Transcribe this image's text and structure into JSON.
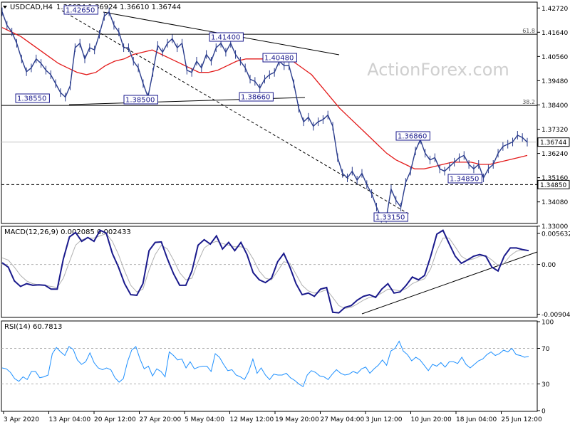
{
  "chart_data": [
    {
      "type": "line",
      "panel": "price",
      "title": "USDCAD,H4",
      "ohlc_header": "1.36624 1.36924 1.36610 1.36744",
      "watermark": "ActionForex.com",
      "ylim": [
        1.3315,
        1.4295
      ],
      "ytick_labels": [
        "1.42720",
        "1.41640",
        "1.40560",
        "1.39480",
        "1.38400",
        "1.37320",
        "1.36240",
        "1.35160",
        "1.34080",
        "1.33000"
      ],
      "ytick_values": [
        1.4272,
        1.4164,
        1.4056,
        1.3948,
        1.384,
        1.3732,
        1.3624,
        1.3516,
        1.3408,
        1.33
      ],
      "xtick_labels": [
        "3 Apr 2020",
        "13 Apr 04:00",
        "20 Apr 12:00",
        "27 Apr 20:00",
        "5 May 04:00",
        "12 May 12:00",
        "19 May 20:00",
        "27 May 04:00",
        "3 Jun 12:00",
        "10 Jun 20:00",
        "18 Jun 04:00",
        "25 Jun 12:00"
      ],
      "fib_levels": [
        {
          "label": "61.8",
          "value": 1.4155
        },
        {
          "label": "38.2",
          "value": 1.3838
        }
      ],
      "reference_levels": [
        {
          "label": "1.36744",
          "value": 1.36744,
          "style": "solid",
          "type": "current"
        },
        {
          "label": "1.34850",
          "value": 1.3485,
          "style": "dashed",
          "type": "support"
        }
      ],
      "annotations": [
        "1.42650",
        "1.41400",
        "1.40480",
        "1.38550",
        "1.38500",
        "1.38660",
        "1.36860",
        "1.34850",
        "1.33150"
      ],
      "annotation_values": [
        1.4265,
        1.414,
        1.4048,
        1.3855,
        1.385,
        1.3866,
        1.3686,
        1.3485,
        1.3315
      ],
      "series": [
        {
          "name": "",
          "color": "#2a3c8c",
          "values": [
            1.4255,
            1.4195,
            1.4165,
            1.4115,
            1.4045,
            1.3988,
            1.4005,
            1.4045,
            1.4025,
            1.3995,
            1.3975,
            1.3935,
            1.3895,
            1.3875,
            1.3925,
            1.4095,
            1.4115,
            1.4045,
            1.4095,
            1.4085,
            1.4155,
            1.4235,
            1.4255,
            1.4195,
            1.4165,
            1.4095,
            1.4095,
            1.4035,
            1.4005,
            1.3935,
            1.3875,
            1.3985,
            1.4105,
            1.4075,
            1.4115,
            1.4135,
            1.4095,
            1.4115,
            1.3995,
            1.3985,
            1.4035,
            1.4005,
            1.4065,
            1.4035,
            1.4095,
            1.4115,
            1.4075,
            1.4115,
            1.4065,
            1.4035,
            1.4005,
            1.3955,
            1.3945,
            1.3915,
            1.3955,
            1.3975,
            1.3985,
            1.4035,
            1.4015,
            1.4015,
            1.3935,
            1.3825,
            1.3765,
            1.3785,
            1.3745,
            1.3765,
            1.3775,
            1.3795,
            1.3745,
            1.3605,
            1.3535,
            1.3515,
            1.3545,
            1.3505,
            1.3535,
            1.3485,
            1.3445,
            1.3385,
            1.3335,
            1.3335,
            1.3465,
            1.3415,
            1.3385,
            1.3495,
            1.3545,
            1.3635,
            1.3685,
            1.3625,
            1.3595,
            1.3605,
            1.3555,
            1.3545,
            1.3565,
            1.3585,
            1.3605,
            1.3615,
            1.3575,
            1.3555,
            1.3575,
            1.3515,
            1.3555,
            1.3575,
            1.3625,
            1.3655,
            1.3665,
            1.3675,
            1.3705,
            1.3695,
            1.3674
          ]
        },
        {
          "name": "",
          "color": "#e31a1a",
          "values": [
            1.4185,
            1.4165,
            1.4145,
            1.4115,
            1.4085,
            1.4055,
            1.4025,
            1.4005,
            1.3985,
            1.3975,
            1.3985,
            1.4015,
            1.4035,
            1.4045,
            1.4065,
            1.4075,
            1.4085,
            1.4065,
            1.4045,
            1.4025,
            1.4005,
            1.3985,
            1.3985,
            1.3995,
            1.4015,
            1.4035,
            1.4045,
            1.4045,
            1.4045,
            1.4055,
            1.4055,
            1.4035,
            1.4005,
            1.3975,
            1.3925,
            1.3875,
            1.3825,
            1.3785,
            1.3745,
            1.3705,
            1.3665,
            1.3625,
            1.3595,
            1.3575,
            1.3555,
            1.3555,
            1.3565,
            1.3575,
            1.3585,
            1.3585,
            1.3585,
            1.3575,
            1.3575,
            1.3585,
            1.3595,
            1.3605,
            1.3615
          ]
        }
      ]
    },
    {
      "type": "line",
      "panel": "macd",
      "title": "MACD(12,26,9) 0.002085 0.002433",
      "ylim": [
        -0.0095,
        0.0068
      ],
      "ytick_labels": [
        "0.005632",
        "0.00",
        "-0.009041"
      ],
      "ytick_values": [
        0.005632,
        0.0,
        -0.009041
      ],
      "series": [
        {
          "name": "",
          "color": "#1a1a8c",
          "values": [
            0.0003,
            -0.0005,
            -0.003,
            -0.004,
            -0.0035,
            -0.0038,
            -0.0037,
            -0.0038,
            -0.0045,
            -0.0045,
            0.001,
            0.005,
            0.0058,
            0.0042,
            0.0049,
            0.0042,
            0.0062,
            0.0057,
            0.002,
            -0.0005,
            -0.0035,
            -0.0055,
            -0.0056,
            -0.0035,
            0.0025,
            0.004,
            0.0041,
            0.001,
            -0.0017,
            -0.0038,
            -0.0038,
            -0.0012,
            0.0035,
            0.0045,
            0.0037,
            0.0052,
            0.0028,
            0.004,
            0.0025,
            0.004,
            0.0018,
            -0.0015,
            -0.0028,
            -0.0033,
            -0.0025,
            0.0005,
            0.002,
            -0.0005,
            -0.0035,
            -0.0055,
            -0.0052,
            -0.0058,
            -0.0045,
            -0.0042,
            -0.0087,
            -0.0088,
            -0.0078,
            -0.0075,
            -0.0065,
            -0.0058,
            -0.0055,
            -0.006,
            -0.0045,
            -0.0035,
            -0.0052,
            -0.005,
            -0.0038,
            -0.0023,
            -0.0028,
            -0.002,
            0.0015,
            0.0055,
            0.0062,
            0.0038,
            0.0015,
            0.0002,
            0.0008,
            0.0015,
            0.0018,
            0.0015,
            -0.0005,
            -0.0012,
            0.0015,
            0.003,
            0.003,
            0.0027,
            0.0025
          ]
        },
        {
          "name": "",
          "color": "#b0b0b0",
          "values": [
            0.0012,
            0.0008,
            -0.0005,
            -0.002,
            -0.003,
            -0.0035,
            -0.0037,
            -0.0038,
            -0.004,
            -0.0042,
            -0.0025,
            0.0005,
            0.0035,
            0.0045,
            0.0048,
            0.0048,
            0.0052,
            0.0056,
            0.0042,
            0.0018,
            -0.0012,
            -0.0038,
            -0.005,
            -0.0045,
            -0.001,
            0.0018,
            0.0035,
            0.0028,
            0.0008,
            -0.0015,
            -0.0028,
            -0.0025,
            0.0005,
            0.003,
            0.0038,
            0.0042,
            0.0038,
            0.0035,
            0.0032,
            0.0032,
            0.0028,
            0.001,
            -0.0012,
            -0.0025,
            -0.0028,
            -0.0012,
            0.0005,
            0.0002,
            -0.0018,
            -0.0038,
            -0.0048,
            -0.0052,
            -0.005,
            -0.0046,
            -0.006,
            -0.0075,
            -0.008,
            -0.0078,
            -0.0072,
            -0.0065,
            -0.006,
            -0.0058,
            -0.0052,
            -0.0045,
            -0.0046,
            -0.0048,
            -0.0044,
            -0.0035,
            -0.003,
            -0.0026,
            -0.0008,
            0.0025,
            0.0048,
            0.0048,
            0.0032,
            0.0015,
            0.0008,
            0.001,
            0.0015,
            0.0016,
            0.0008,
            -0.0002,
            0.0002,
            0.0016,
            0.0024,
            0.0026,
            0.0025
          ]
        }
      ]
    },
    {
      "type": "line",
      "panel": "rsi",
      "title": "RSI(14) 60.7813",
      "ylim": [
        0,
        100
      ],
      "ytick_labels": [
        "100",
        "70",
        "30",
        "0"
      ],
      "ytick_values": [
        100,
        70,
        30,
        0
      ],
      "series": [
        {
          "name": "",
          "color": "#1e90ff",
          "values": [
            48,
            47,
            43,
            36,
            33,
            38,
            35,
            44,
            44,
            37,
            38,
            40,
            64,
            71,
            66,
            62,
            72,
            69,
            57,
            52,
            55,
            65,
            54,
            48,
            46,
            48,
            46,
            37,
            32,
            36,
            55,
            68,
            72,
            58,
            47,
            50,
            39,
            47,
            44,
            38,
            66,
            62,
            57,
            58,
            48,
            55,
            47,
            49,
            50,
            50,
            44,
            64,
            60,
            52,
            45,
            46,
            40,
            38,
            35,
            44,
            58,
            42,
            48,
            40,
            35,
            41,
            40,
            40,
            42,
            37,
            34,
            30,
            27,
            40,
            45,
            43,
            39,
            38,
            35,
            41,
            46,
            42,
            40,
            41,
            44,
            42,
            47,
            49,
            42,
            47,
            51,
            57,
            51,
            67,
            70,
            78,
            67,
            63,
            56,
            60,
            57,
            51,
            45,
            52,
            50,
            54,
            49,
            55,
            55,
            53,
            60,
            52,
            48,
            52,
            56,
            58,
            63,
            66,
            62,
            64,
            68,
            66,
            70,
            63,
            62,
            60,
            61
          ]
        }
      ]
    }
  ]
}
